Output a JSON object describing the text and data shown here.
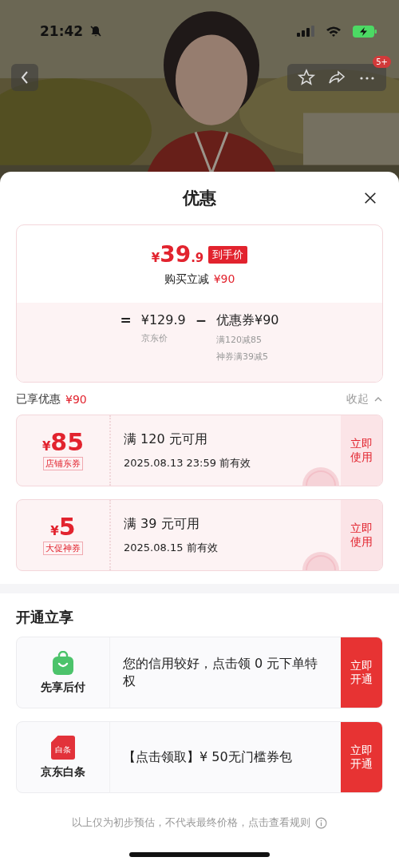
{
  "status_bar": {
    "time": "21:42",
    "muted": true
  },
  "nav": {
    "badge": "5+"
  },
  "sheet": {
    "title": "优惠"
  },
  "summary": {
    "currency": "¥",
    "price_int": "39",
    "price_dec": ".9",
    "price_tag": "到手价",
    "saving_label": "购买立减",
    "saving_value": "¥90",
    "equals": "=",
    "base_price": "¥129.9",
    "base_label": "京东价",
    "minus": "−",
    "coupon_total": "优惠券¥90",
    "coupon_details": [
      "满120减85",
      "神券满39减5"
    ]
  },
  "enjoyed": {
    "label": "已享优惠",
    "value": "¥90",
    "toggle": "收起",
    "expanded": true
  },
  "coupons": [
    {
      "currency": "¥",
      "amount": "85",
      "tag": "店铺东券",
      "condition": "满 120 元可用",
      "validity": "2025.08.13 23:59 前有效",
      "action": "立即使用",
      "claimed": true
    },
    {
      "currency": "¥",
      "amount": "5",
      "tag": "大促神券",
      "condition": "满 39 元可用",
      "validity": "2025.08.15 前有效",
      "action": "立即使用",
      "claimed": true
    }
  ],
  "open_section": {
    "title": "开通立享"
  },
  "services": [
    {
      "kind": "bag",
      "name": "先享后付",
      "text": "您的信用较好，点击领 0 元下单特权",
      "action": "立即开通"
    },
    {
      "kind": "baitiao",
      "name": "京东白条",
      "icon_text": "白条",
      "text": "【点击领取】¥ 50无门槛券包",
      "action": "立即开通"
    }
  ],
  "footer": {
    "text": "以上仅为初步预估，不代表最终价格，点击查看规则"
  }
}
